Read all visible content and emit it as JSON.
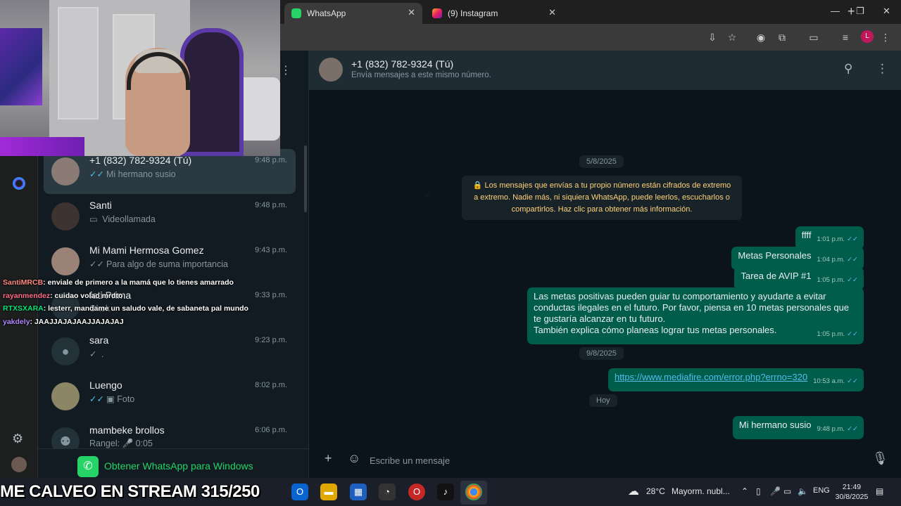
{
  "browser": {
    "tabs": [
      {
        "label": "WhatsApp",
        "active": true,
        "icon": "whatsapp-icon"
      },
      {
        "label": "(9) Instagram",
        "active": false,
        "icon": "instagram-icon"
      }
    ],
    "new_tab": "+",
    "window_controls": {
      "minimize": "—",
      "maximize": "❐",
      "close": "✕"
    },
    "profile_initial": "L"
  },
  "chat_list": [
    {
      "name": "+1 (832) 782-9324 (Tú)",
      "time": "9:48 p.m.",
      "preview": "Mi hermano susio",
      "tick": "✓✓",
      "selected": true
    },
    {
      "name": "Santi",
      "time": "9:48 p.m.",
      "preview": "Videollamada",
      "preview_icon": "▭"
    },
    {
      "name": "Mi Mami Hermosa Gomez",
      "time": "9:43 p.m.",
      "preview": "Para algo de suma importancia",
      "tick": "✓✓"
    },
    {
      "name": "fati Prima",
      "time": "9:33 p.m.",
      "preview": "Okok"
    },
    {
      "name": "sara",
      "time": "9:23 p.m.",
      "preview": ".",
      "tick": "✓"
    },
    {
      "name": "Luengo",
      "time": "8:02 p.m.",
      "preview": "Foto",
      "tick": "✓✓",
      "preview_icon": "▣"
    },
    {
      "name": "mambeke brollos",
      "time": "6:06 p.m.",
      "preview": "Rangel: 🎤 0:05"
    }
  ],
  "get_app": "Obtener WhatsApp para Windows",
  "chat_header": {
    "title": "+1 (832) 782-9324 (Tú)",
    "subtitle": "Envía mensajes a este mismo número."
  },
  "dates": {
    "d1": "5/8/2025",
    "d2": "9/8/2025",
    "d3": "Hoy"
  },
  "notice": "🔒 Los mensajes que envías a tu propio número están cifrados de extremo a extremo. Nadie más, ni siquiera WhatsApp, puede leerlos, escucharlos o compartirlos. Haz clic para obtener más información.",
  "messages": [
    {
      "text": "ffff",
      "time": "1:01 p.m."
    },
    {
      "text": "Metas Personales",
      "time": "1:04 p.m."
    },
    {
      "text": "Tarea de AVIP #1",
      "time": "1:05 p.m."
    },
    {
      "text": "Las metas positivas pueden guiar tu comportamiento y ayudarte a evitar conductas ilegales en el futuro. Por favor, piensa en 10 metas personales que te gustaría alcanzar en tu futuro.",
      "text2": "También explica cómo planeas lograr tus metas personales.",
      "time": "1:05 p.m."
    },
    {
      "link": "https://www.mediafire.com/error.php?errno=320",
      "time": "10:53 a.m."
    },
    {
      "text": "Mi hermano susio",
      "time": "9:48 p.m."
    }
  ],
  "read_ticks": "✓✓",
  "composer": {
    "placeholder": "Escribe un mensaje"
  },
  "stream_chat": [
    {
      "user": "SantiMRCB",
      "msg": ": enviale de primero a la mamá que lo tienes amarrado"
    },
    {
      "user": "rayanmendez",
      "msg": ": cuidao volao mrdto"
    },
    {
      "user": "RTXSXARA",
      "msg": ": lesterr, mandame un saludo vale, de sabaneta pal mundo"
    },
    {
      "user": "yakdely",
      "msg": ": JAAJJAJAJAAJJAJAJAJ"
    }
  ],
  "banner": "ME CALVEO EN STREAM 315/250",
  "taskbar": {
    "weather_temp": "28°C",
    "weather_desc": "Mayorm. nubl...",
    "lang": "ENG",
    "time": "21:49",
    "date": "30/8/2025"
  },
  "colors": {
    "accent": "#25d366",
    "bubble": "#005c4b",
    "read_tick": "#53bdeb"
  }
}
